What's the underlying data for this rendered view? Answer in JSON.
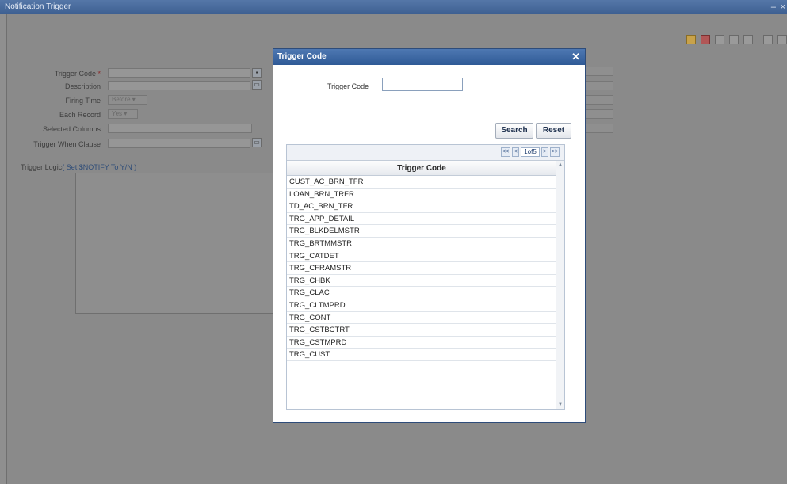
{
  "window": {
    "title": "Notification Trigger",
    "min_glyph": "–",
    "close_glyph": "×"
  },
  "form": {
    "trigger_code_label": "Trigger Code",
    "required_mark": "*",
    "description_label": "Description",
    "firing_time_label": "Firing Time",
    "firing_time_value": "Before",
    "each_record_label": "Each Record",
    "each_record_value": "Yes",
    "selected_columns_label": "Selected Columns",
    "trigger_when_clause_label": "Trigger When Clause",
    "trigger_logic_label": "Trigger Logic",
    "trigger_logic_link": "Set $NOTIFY To Y/N"
  },
  "modal": {
    "title": "Trigger Code",
    "close_glyph": "✕",
    "search_label": "Trigger Code",
    "search_value": "",
    "search_button": "Search",
    "reset_button": "Reset",
    "pager": {
      "first": "<<",
      "prev": "<",
      "page_display": "1of5",
      "next": ">",
      "last": ">>"
    },
    "column_header": "Trigger Code",
    "rows": [
      "CUST_AC_BRN_TFR",
      "LOAN_BRN_TRFR",
      "TD_AC_BRN_TFR",
      "TRG_APP_DETAIL",
      "TRG_BLKDELMSTR",
      "TRG_BRTMMSTR",
      "TRG_CATDET",
      "TRG_CFRAMSTR",
      "TRG_CHBK",
      "TRG_CLAC",
      "TRG_CLTMPRD",
      "TRG_CONT",
      "TRG_CSTBCTRT",
      "TRG_CSTMPRD",
      "TRG_CUST"
    ]
  },
  "colors": {
    "title_bar": "#3d5f91",
    "modal_title_bar": "#2f5a96",
    "overlay": "#8a8a8a"
  }
}
